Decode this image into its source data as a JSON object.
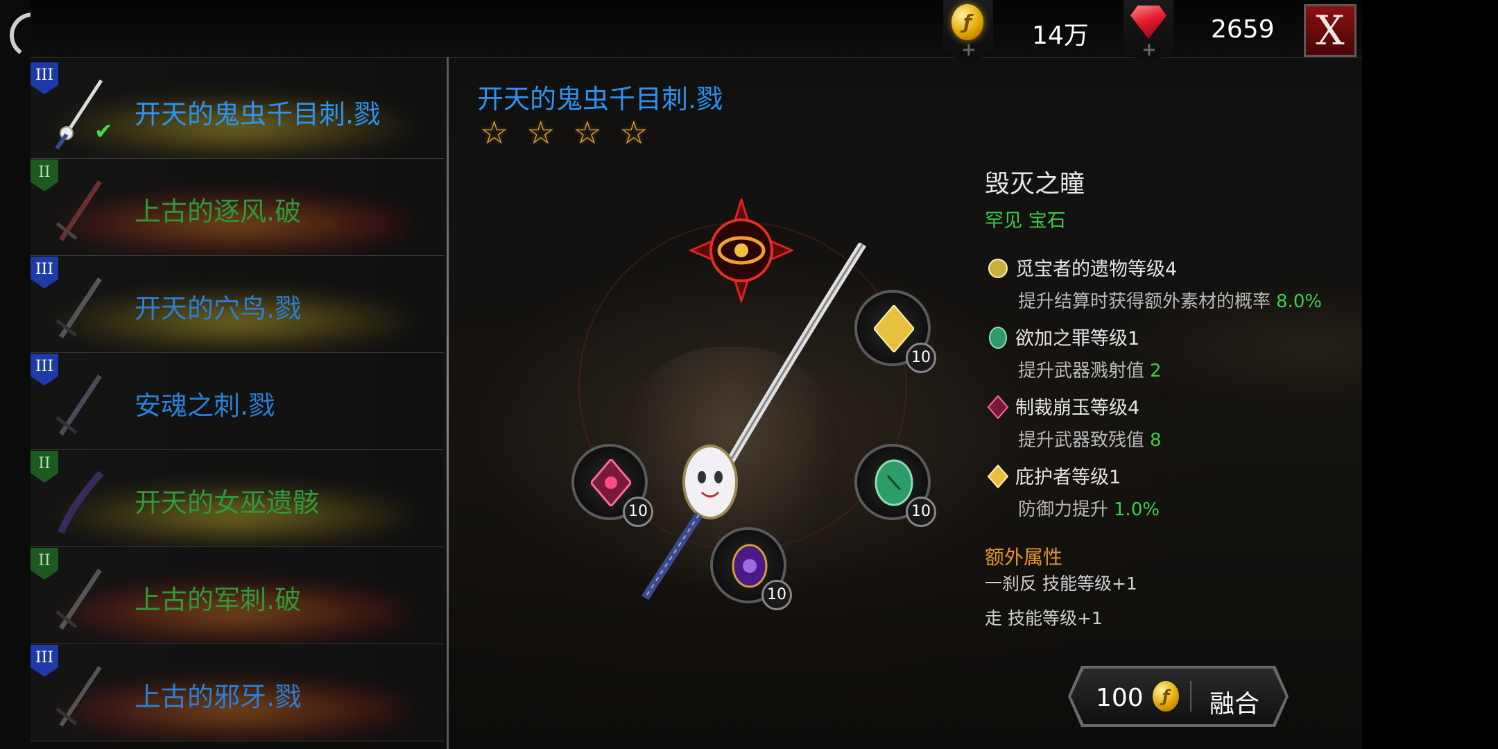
{
  "topbar": {
    "gold_amount": "14万",
    "gold_icon": "gold-coin-icon",
    "gem_amount": "2659",
    "gem_icon": "red-gem-icon",
    "plus_symbol": "+",
    "close_label": "X"
  },
  "weapon_list": [
    {
      "tier": "III",
      "name": "开天的鬼虫千目刺.戮",
      "color": "#2d93f0",
      "selected": true,
      "equipped": true
    },
    {
      "tier": "II",
      "name": "上古的逐风.破",
      "color": "#2f9a3a",
      "selected": false,
      "equipped": false
    },
    {
      "tier": "III",
      "name": "开天的穴鸟.戮",
      "color": "#2d7fd6",
      "selected": false,
      "equipped": false
    },
    {
      "tier": "III",
      "name": "安魂之刺.戮",
      "color": "#2d7fd6",
      "selected": false,
      "equipped": false
    },
    {
      "tier": "II",
      "name": "开天的女巫遗骸",
      "color": "#2f9a3a",
      "selected": false,
      "equipped": false
    },
    {
      "tier": "II",
      "name": "上古的军刺.破",
      "color": "#2f9a3a",
      "selected": false,
      "equipped": false
    },
    {
      "tier": "III",
      "name": "上古的邪牙.戮",
      "color": "#2d7fd6",
      "selected": false,
      "equipped": false
    }
  ],
  "item": {
    "title": "开天的鬼虫千目刺.戮",
    "star_count": 4,
    "star_glyph": "☆"
  },
  "sockets": [
    {
      "name": "yellow-gem",
      "level": "10",
      "color": "#e8c040"
    },
    {
      "name": "pink-gem",
      "level": "10",
      "color": "#d83a7a"
    },
    {
      "name": "green-gem",
      "level": "10",
      "color": "#2f9a6a"
    },
    {
      "name": "purple-gem",
      "level": "10",
      "color": "#7a3ad0"
    }
  ],
  "gem_info": {
    "title": "毁灭之瞳",
    "subtitle": "罕见 宝石",
    "effects": [
      {
        "icon": "golden-relic-icon",
        "name": "觅宝者的遗物等级4",
        "desc": "提升结算时获得额外素材的概率",
        "value": "8.0%"
      },
      {
        "icon": "green-gem-icon",
        "name": "欲加之罪等级1",
        "desc": "提升武器溅射值",
        "value": "2"
      },
      {
        "icon": "pink-gem-icon",
        "name": "制裁崩玉等级4",
        "desc": "提升武器致残值",
        "value": "8"
      },
      {
        "icon": "yellow-crystal-icon",
        "name": "庇护者等级1",
        "desc": "防御力提升",
        "value": "1.0%"
      }
    ],
    "extra_header": "额外属性",
    "extra_lines": [
      "一刹反 技能等级+1",
      "走 技能等级+1"
    ]
  },
  "fuse": {
    "cost": "100",
    "label": "融合"
  },
  "colors": {
    "title_blue": "#2d93f0",
    "rare_green": "#3cc847",
    "value_green": "#3cd04a",
    "extra_orange": "#e8962a"
  }
}
